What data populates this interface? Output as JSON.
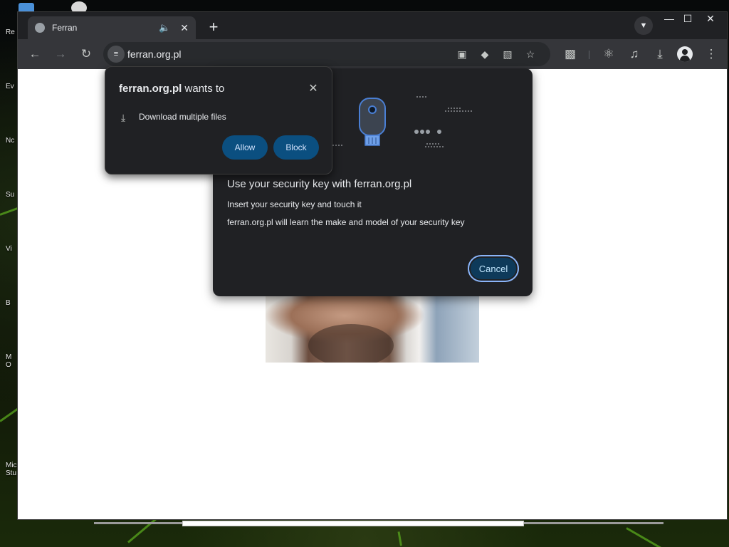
{
  "desktop": {
    "labels": [
      "Re",
      "Ev",
      "Nc",
      "Su",
      "Vi",
      "B",
      "M O",
      "Micr Stu"
    ]
  },
  "browser": {
    "tab": {
      "title": "Ferran",
      "audio_icon": "speaker-icon",
      "close_icon": "close-icon"
    },
    "new_tab_icon": "plus-icon",
    "tab_search_icon": "chevron-down-icon",
    "window_controls": [
      "minimize-icon",
      "maximize-icon",
      "close-icon"
    ],
    "toolbar": {
      "back_icon": "arrow-left-icon",
      "forward_icon": "arrow-right-icon",
      "reload_icon": "reload-icon",
      "url": "ferran.org.pl",
      "omnibox_icons": [
        "camera-blocked-icon",
        "google-lens-icon",
        "translate-icon",
        "star-icon"
      ],
      "extensions_icon": "puzzle-icon",
      "labs_icon": "flask-icon",
      "media_icon": "media-control-icon",
      "download_icon": "download-icon",
      "profile_icon": "profile-icon",
      "menu_icon": "more-vert-icon"
    }
  },
  "permission_prompt": {
    "site": "ferran.org.pl",
    "wants_to": " wants to",
    "item_icon": "download-icon",
    "item_text": "Download multiple files",
    "allow_label": "Allow",
    "block_label": "Block",
    "close_icon": "close-icon"
  },
  "security_key_dialog": {
    "title": "Use your security key with ferran.org.pl",
    "line1": "Insert your security key and touch it",
    "line2": "ferran.org.pl will learn the make and model of your security key",
    "cancel_label": "Cancel",
    "illustration_icon": "usb-security-key-icon"
  },
  "colors": {
    "dialog_bg": "#202124",
    "button_bg": "#0b4f80",
    "accent": "#8ab4f8",
    "key_blue": "#4a7fd4"
  }
}
